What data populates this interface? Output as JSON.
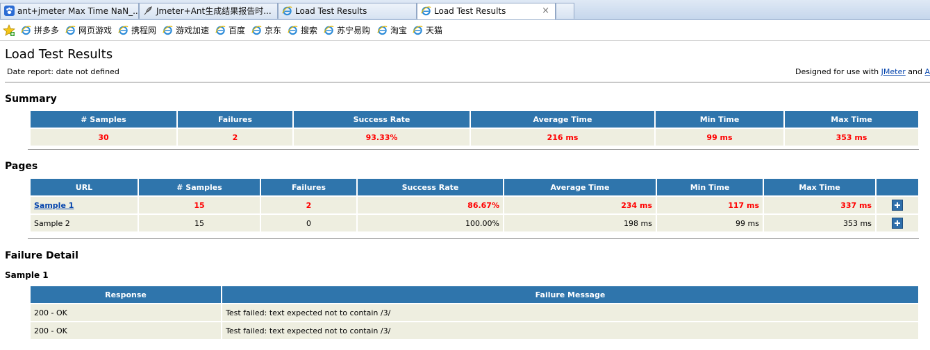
{
  "browser": {
    "tabs": [
      {
        "label": "ant+jmeter Max Time NaN_..."
      },
      {
        "label": "Jmeter+Ant生成结果报告时..."
      },
      {
        "label": "Load Test Results"
      },
      {
        "label": "Load Test Results"
      }
    ],
    "close_glyph": "×",
    "favorites": [
      {
        "label": "拼多多"
      },
      {
        "label": "网页游戏"
      },
      {
        "label": "携程网"
      },
      {
        "label": "游戏加速"
      },
      {
        "label": "百度"
      },
      {
        "label": "京东"
      },
      {
        "label": "搜索"
      },
      {
        "label": "苏宁易购"
      },
      {
        "label": "淘宝"
      },
      {
        "label": "天猫"
      }
    ]
  },
  "page": {
    "title": "Load Test Results",
    "date_report": "Date report: date not defined",
    "designed_prefix": "Designed for use with",
    "designed_link1": "JMeter",
    "designed_and": "and",
    "designed_link2": "A"
  },
  "summary": {
    "title": "Summary",
    "headers": [
      "# Samples",
      "Failures",
      "Success Rate",
      "Average Time",
      "Min Time",
      "Max Time"
    ],
    "row": [
      "30",
      "2",
      "93.33%",
      "216 ms",
      "99 ms",
      "353 ms"
    ]
  },
  "pages": {
    "title": "Pages",
    "headers": [
      "URL",
      "# Samples",
      "Failures",
      "Success Rate",
      "Average Time",
      "Min Time",
      "Max Time"
    ],
    "rows": [
      {
        "url": "Sample 1",
        "samples": "15",
        "failures": "2",
        "success_rate": "86.67%",
        "avg": "234 ms",
        "min": "117 ms",
        "max": "337 ms"
      },
      {
        "url": "Sample 2",
        "samples": "15",
        "failures": "0",
        "success_rate": "100.00%",
        "avg": "198 ms",
        "min": "99 ms",
        "max": "353 ms"
      }
    ]
  },
  "failure_detail": {
    "title": "Failure Detail",
    "sample_title": "Sample 1",
    "headers": [
      "Response",
      "Failure Message"
    ],
    "rows": [
      {
        "response": "200 - OK",
        "message": "Test failed: text expected not to contain /3/"
      },
      {
        "response": "200 - OK",
        "message": "Test failed: text expected not to contain /3/"
      }
    ]
  },
  "colors": {
    "header_bg": "#2f75ac",
    "cell_bg": "#eeeee0",
    "failure_text": "#ff0000",
    "link": "#0645ad"
  }
}
